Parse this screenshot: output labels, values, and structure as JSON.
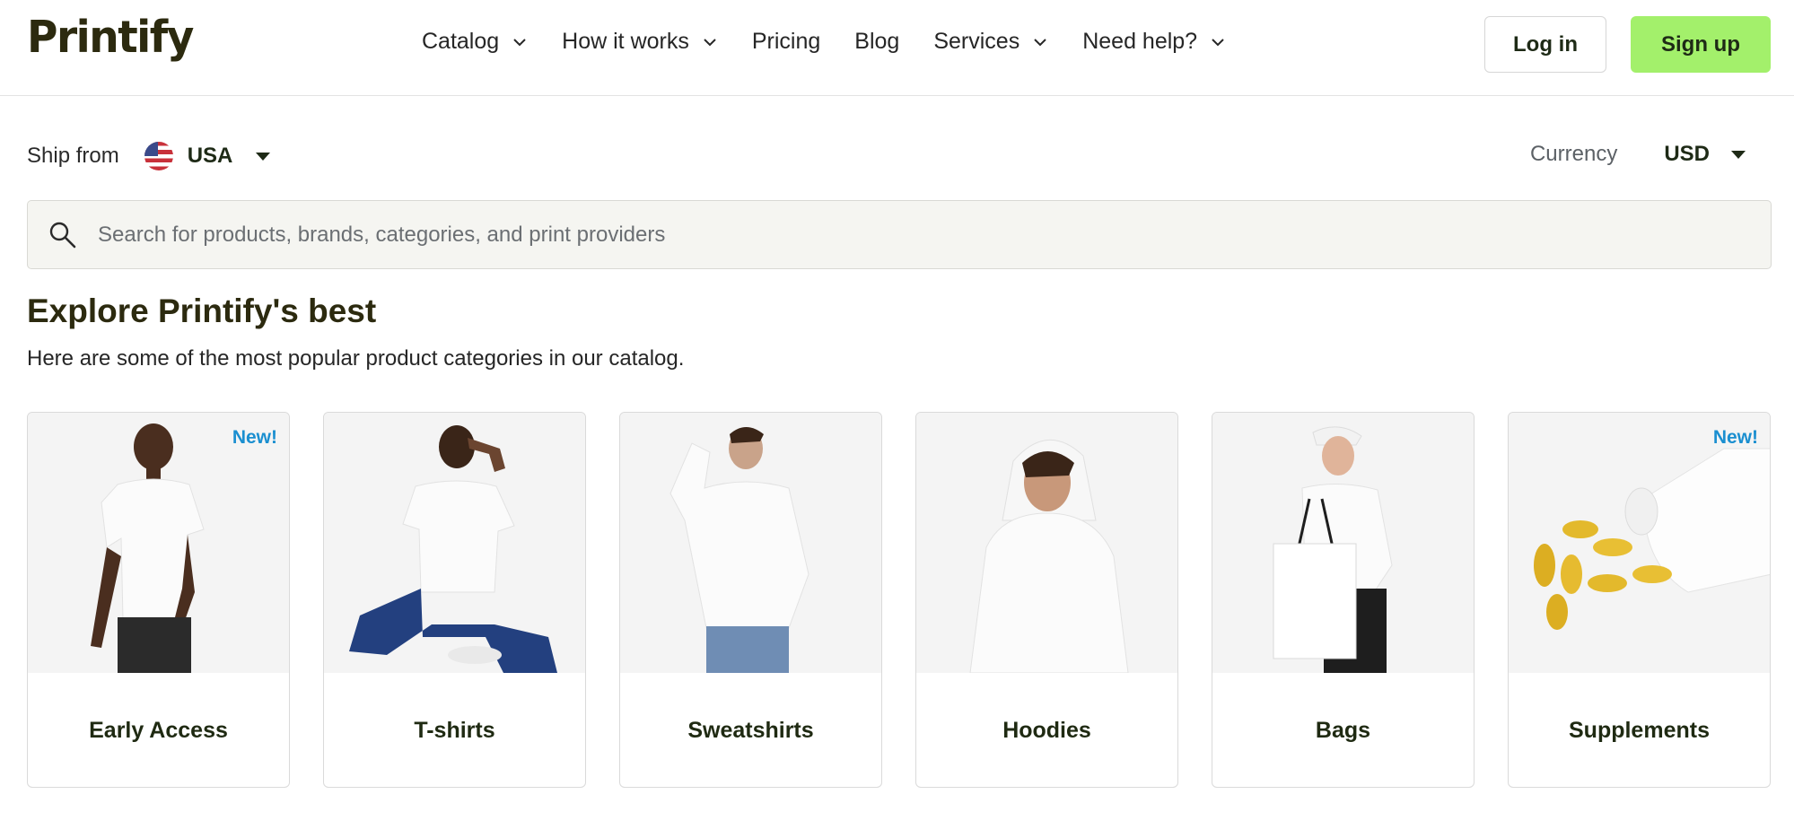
{
  "header": {
    "logo": "Printify",
    "nav": [
      {
        "label": "Catalog",
        "has_dropdown": true
      },
      {
        "label": "How it works",
        "has_dropdown": true
      },
      {
        "label": "Pricing",
        "has_dropdown": false
      },
      {
        "label": "Blog",
        "has_dropdown": false
      },
      {
        "label": "Services",
        "has_dropdown": true
      },
      {
        "label": "Need help?",
        "has_dropdown": true
      }
    ],
    "login_label": "Log in",
    "signup_label": "Sign up"
  },
  "ship_from": {
    "label": "Ship from",
    "value": "USA",
    "flag_icon": "us-flag-icon"
  },
  "currency": {
    "label": "Currency",
    "value": "USD"
  },
  "search": {
    "placeholder": "Search for products, brands, categories, and print providers",
    "value": ""
  },
  "section": {
    "title": "Explore Printify's best",
    "subtitle": "Here are some of the most popular product categories in our catalog."
  },
  "categories": [
    {
      "label": "Early Access",
      "badge": "New!"
    },
    {
      "label": "T-shirts",
      "badge": ""
    },
    {
      "label": "Sweatshirts",
      "badge": ""
    },
    {
      "label": "Hoodies",
      "badge": ""
    },
    {
      "label": "Bags",
      "badge": ""
    },
    {
      "label": "Supplements",
      "badge": "New!"
    }
  ],
  "colors": {
    "accent": "#a3f06b",
    "badge": "#1b8fd0",
    "brand_text": "#2c2a0f"
  }
}
